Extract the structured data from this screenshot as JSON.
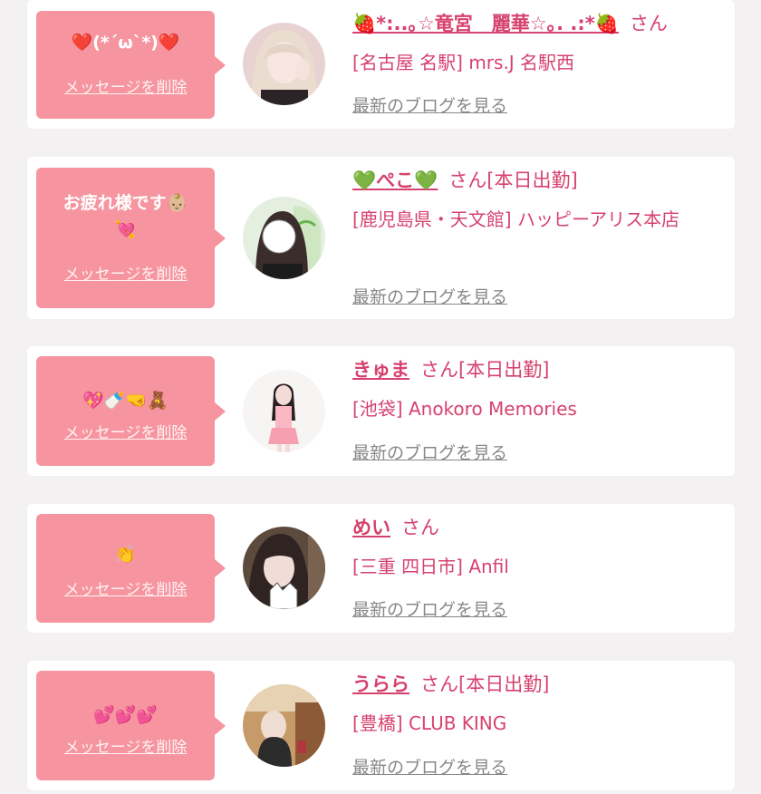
{
  "favorites": [
    {
      "message": "❤️(*´ω`*)❤️",
      "delete_label": "メッセージを削除",
      "name": "🍓*:..｡☆竜宮　麗華☆｡. .:*🍓",
      "honorific": "さん",
      "status": "",
      "shop": "[名古屋 名駅] mrs.J 名駅西",
      "blog_label": "最新のブログを見る"
    },
    {
      "message": "お疲れ様です👶🏼\n💘",
      "delete_label": "メッセージを削除",
      "name": "💚ぺこ💚",
      "honorific": "さん",
      "status": "[本日出勤]",
      "shop": "[鹿児島県・天文館] ハッピーアリス本店",
      "blog_label": "最新のブログを見る"
    },
    {
      "message": "💖🍼🤜🧸",
      "delete_label": "メッセージを削除",
      "name": "きゅま",
      "honorific": "さん",
      "status": "[本日出勤]",
      "shop": "[池袋] Anokoro Memories",
      "blog_label": "最新のブログを見る"
    },
    {
      "message": "👏",
      "delete_label": "メッセージを削除",
      "name": "めい",
      "honorific": "さん",
      "status": "",
      "shop": "[三重 四日市] Anfil",
      "blog_label": "最新のブログを見る"
    },
    {
      "message": "💕💕💕",
      "delete_label": "メッセージを削除",
      "name": "うらら",
      "honorific": "さん",
      "status": "[本日出勤]",
      "shop": "[豊橋] CLUB KING",
      "blog_label": "最新のブログを見る"
    }
  ],
  "colors": {
    "bubble": "#f6959f",
    "accent": "#d6426f",
    "link_gray": "#888888",
    "page_bg": "#f3f1f2"
  }
}
